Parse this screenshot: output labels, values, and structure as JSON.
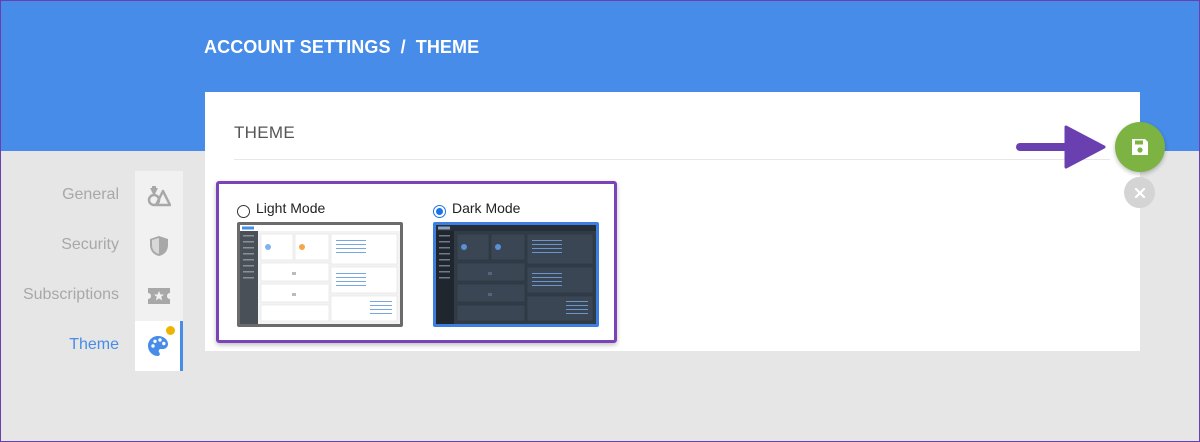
{
  "breadcrumb": {
    "parent": "ACCOUNT SETTINGS",
    "separator": "/",
    "current": "THEME"
  },
  "sidebar": {
    "items": [
      {
        "label": "General",
        "icon": "shapes-icon",
        "active": false
      },
      {
        "label": "Security",
        "icon": "shield-icon",
        "active": false
      },
      {
        "label": "Subscriptions",
        "icon": "ticket-star-icon",
        "active": false
      },
      {
        "label": "Theme",
        "icon": "palette-icon",
        "active": true
      }
    ]
  },
  "card": {
    "title": "THEME"
  },
  "theme_options": [
    {
      "label": "Light Mode",
      "selected": false
    },
    {
      "label": "Dark Mode",
      "selected": true
    }
  ],
  "colors": {
    "header": "#468ce8",
    "accent": "#468ce8",
    "save": "#7cb342",
    "highlight_frame": "#7a44b8",
    "notification_dot": "#f0b400"
  }
}
